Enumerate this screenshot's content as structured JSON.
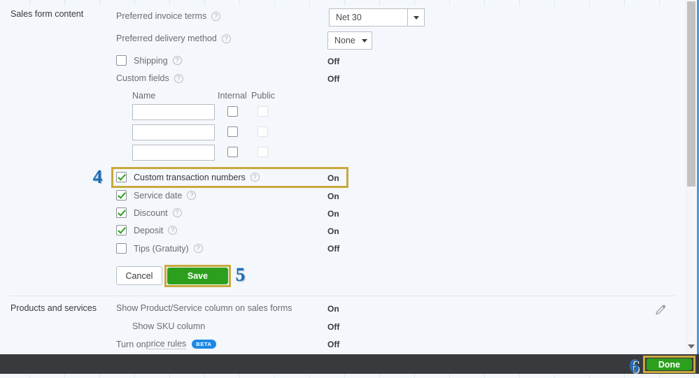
{
  "sections": [
    {
      "title": "Sales form content",
      "rows": [
        {
          "label": "Preferred invoice terms",
          "help": true,
          "control": "select",
          "value": "Net 30"
        },
        {
          "label": "Preferred delivery method",
          "help": true,
          "control": "select",
          "value": "None"
        },
        {
          "label": "Shipping",
          "help": true,
          "control": "checkbox",
          "checked": false,
          "status": "Off"
        },
        {
          "label": "Custom fields",
          "help": true,
          "control": "none",
          "status": "Off"
        }
      ],
      "custom_fields": {
        "headers": [
          "Name",
          "Internal",
          "Public"
        ],
        "rows": [
          {
            "name": "",
            "internal": false,
            "public": false
          },
          {
            "name": "",
            "internal": false,
            "public": false
          },
          {
            "name": "",
            "internal": false,
            "public": false
          }
        ]
      },
      "toggles": [
        {
          "label": "Custom transaction numbers",
          "checked": true,
          "status": "On",
          "highlighted": true,
          "step": "4"
        },
        {
          "label": "Service date",
          "checked": true,
          "status": "On"
        },
        {
          "label": "Discount",
          "checked": true,
          "status": "On"
        },
        {
          "label": "Deposit",
          "checked": true,
          "status": "On"
        },
        {
          "label": "Tips (Gratuity)",
          "checked": false,
          "status": "Off"
        }
      ],
      "buttons": {
        "cancel": "Cancel",
        "save": "Save",
        "save_step": "5"
      }
    },
    {
      "title": "Products and services",
      "rows": [
        {
          "label": "Show Product/Service column on sales forms",
          "status": "On"
        },
        {
          "label": "Show SKU column",
          "status": "Off",
          "indent": true
        },
        {
          "label": "Turn on price rules",
          "link_text": "price rules",
          "prefix": "Turn on ",
          "badge": "BETA",
          "status": "Off"
        }
      ],
      "edit_icon": "pencil-icon"
    }
  ],
  "footer": {
    "done_label": "Done",
    "done_step": "6"
  },
  "colors": {
    "accent_green": "#2ca01c",
    "highlight_gold": "#c8a93b",
    "step_blue": "#1f6bb5",
    "beta_blue": "#1c89e5",
    "footer_dark": "#393a3d",
    "page_bg": "#f4f7fb"
  }
}
